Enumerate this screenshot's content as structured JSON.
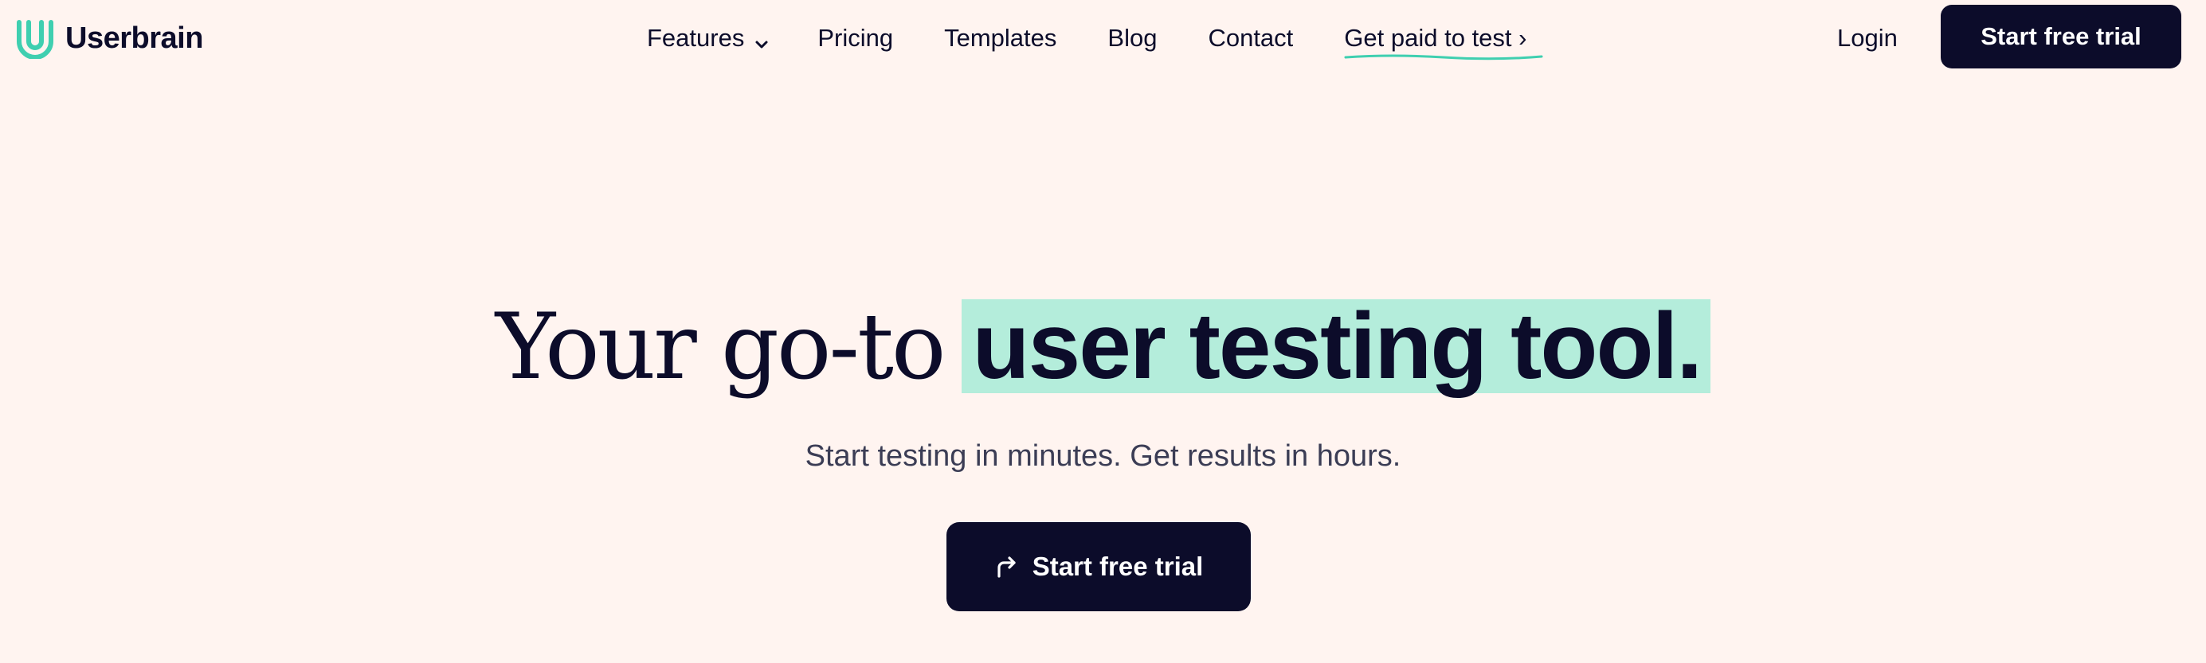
{
  "brand": {
    "name": "Userbrain",
    "logo_icon": "userbrain-u-logo-icon",
    "accent_color": "#3fcfb0",
    "highlight_color": "#b4eddb",
    "dark_color": "#0c0c2a",
    "background_color": "#fff4f0"
  },
  "nav": {
    "features": "Features",
    "features_icon": "chevron-down-icon",
    "pricing": "Pricing",
    "templates": "Templates",
    "blog": "Blog",
    "contact": "Contact",
    "get_paid": "Get paid to test ›"
  },
  "header": {
    "login": "Login",
    "cta": "Start free trial"
  },
  "hero": {
    "title_plain": "Your go-to",
    "title_highlight": "user testing tool.",
    "subtitle": "Start testing in minutes. Get results in hours.",
    "cta": "Start free trial",
    "cta_icon": "redirect-arrow-icon"
  }
}
